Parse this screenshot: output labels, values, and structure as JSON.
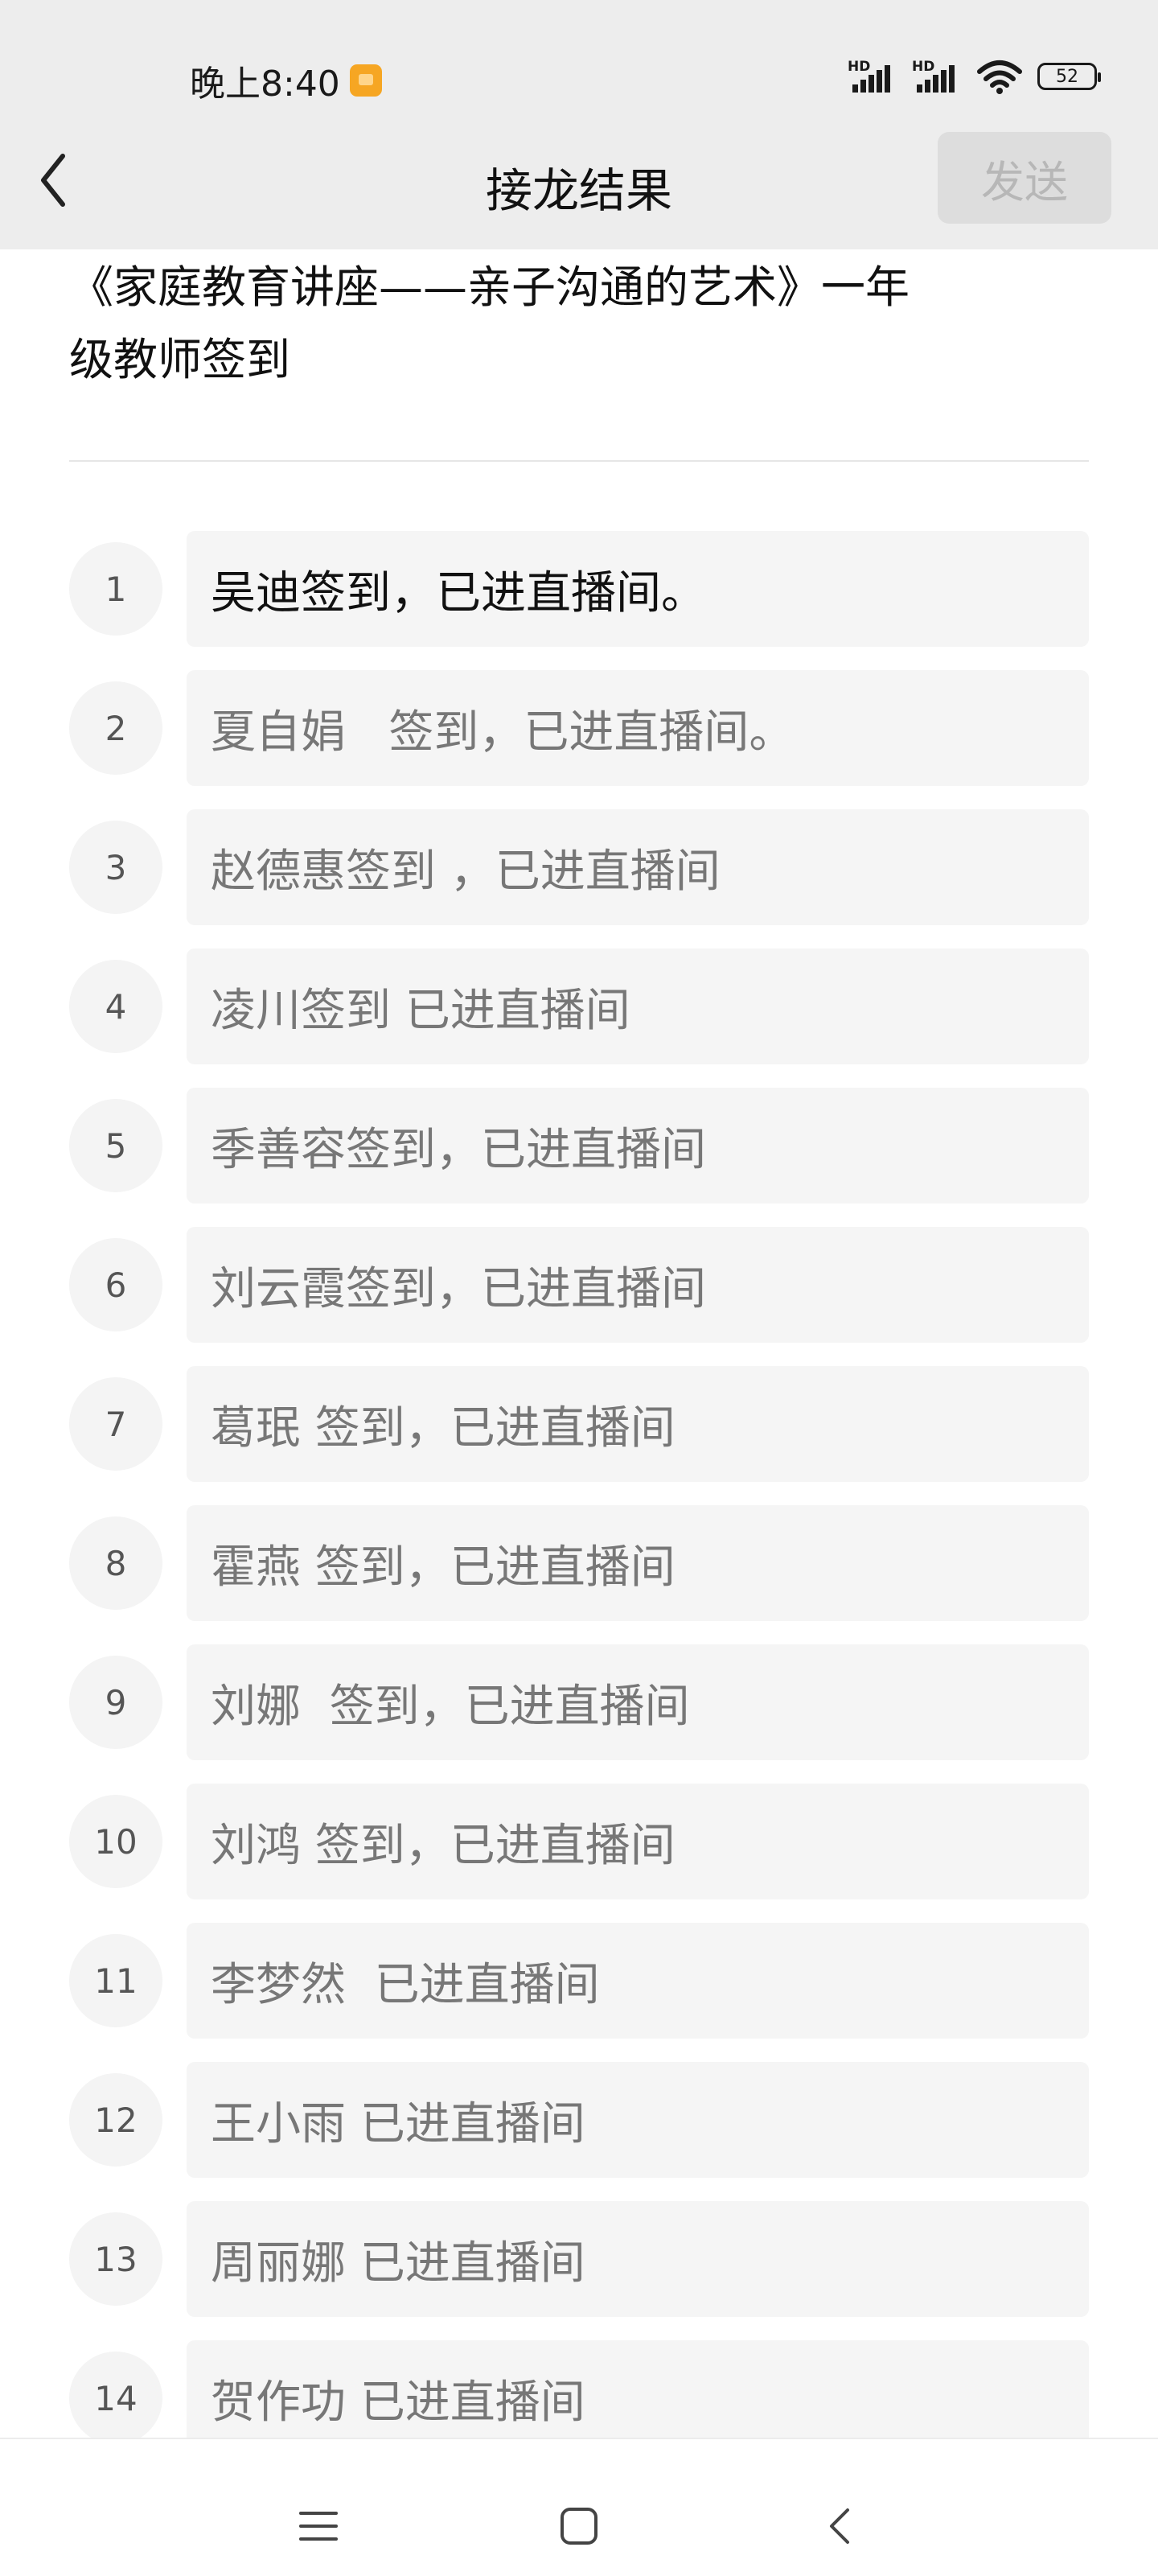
{
  "status_bar": {
    "time": "晚上8:40",
    "signal1_label": "HD",
    "signal2_label": "HD",
    "battery": "52",
    "icons": [
      "app-notification-icon",
      "signal-icon",
      "signal-icon",
      "wifi-icon",
      "battery-icon"
    ]
  },
  "nav": {
    "back_icon": "back-chevron-icon",
    "title": "接龙结果",
    "send_label": "发送"
  },
  "document": {
    "title_line1": "《家庭教育讲座——亲子沟通的艺术》一年",
    "title_line2": "级教师签到"
  },
  "entries": [
    {
      "index": "1",
      "text": "吴迪签到，已进直播间。"
    },
    {
      "index": "2",
      "text": "夏自娟   签到，已进直播间。"
    },
    {
      "index": "3",
      "text": "赵德惠签到 ，已进直播间"
    },
    {
      "index": "4",
      "text": "凌川签到 已进直播间"
    },
    {
      "index": "5",
      "text": "季善容签到，已进直播间"
    },
    {
      "index": "6",
      "text": "刘云霞签到，已进直播间"
    },
    {
      "index": "7",
      "text": "葛珉 签到，已进直播间"
    },
    {
      "index": "8",
      "text": "霍燕 签到，已进直播间"
    },
    {
      "index": "9",
      "text": "刘娜  签到，已进直播间"
    },
    {
      "index": "10",
      "text": "刘鸿 签到，已进直播间"
    },
    {
      "index": "11",
      "text": "李梦然  已进直播间"
    },
    {
      "index": "12",
      "text": "王小雨 已进直播间"
    },
    {
      "index": "13",
      "text": "周丽娜 已进直播间"
    },
    {
      "index": "14",
      "text": "贺作功 已进直播间"
    }
  ],
  "bottom_nav": {
    "icons": [
      "menu-icon",
      "home-icon",
      "back-icon"
    ]
  }
}
